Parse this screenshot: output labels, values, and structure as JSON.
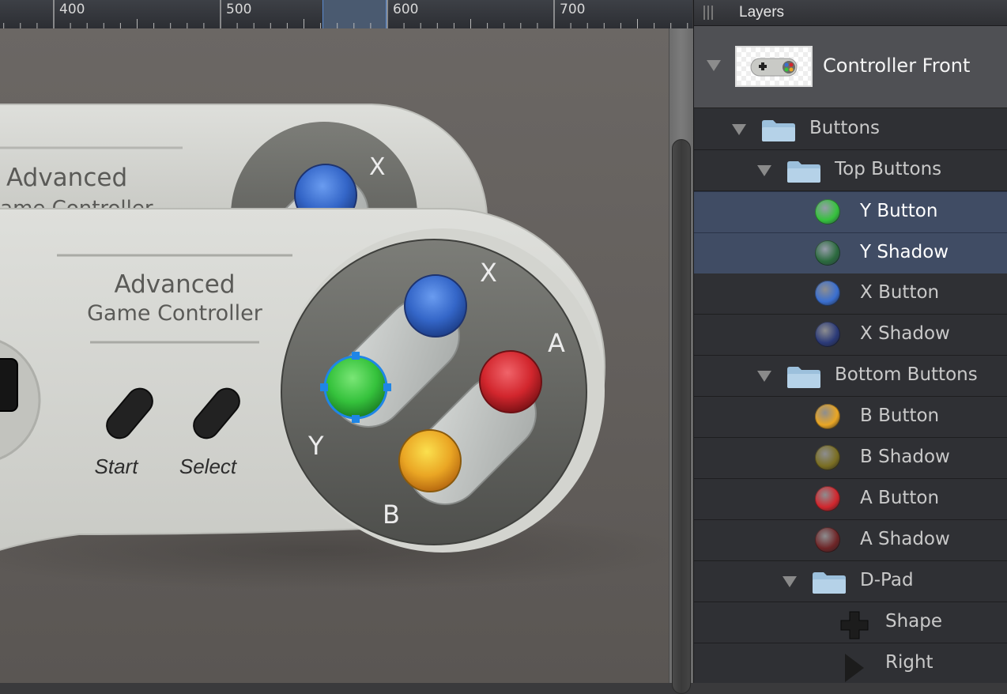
{
  "ruler": {
    "labels": [
      "400",
      "500",
      "600",
      "700"
    ]
  },
  "controller": {
    "title_line1": "Advanced",
    "title_line2": "Game Controller",
    "start_label": "Start",
    "select_label": "Select",
    "letter_x": "X",
    "letter_y": "Y",
    "letter_a": "A",
    "letter_b": "B"
  },
  "layers": {
    "title": "Layers",
    "root": {
      "name": "Controller Front"
    },
    "rows": [
      {
        "label": "Buttons",
        "kind": "folder",
        "selected": false
      },
      {
        "label": "Top Buttons",
        "kind": "folder",
        "selected": false
      },
      {
        "label": "Y Button",
        "kind": "dot",
        "color": "#35c23c",
        "selected": true
      },
      {
        "label": "Y Shadow",
        "kind": "dot",
        "color": "#2b6a3e",
        "selected": true
      },
      {
        "label": "X Button",
        "kind": "dot",
        "color": "#3a6fd0",
        "selected": false
      },
      {
        "label": "X Shadow",
        "kind": "dot",
        "color": "#2b3a78",
        "selected": false
      },
      {
        "label": "Bottom Buttons",
        "kind": "folder",
        "selected": false
      },
      {
        "label": "B Button",
        "kind": "dot",
        "color": "#eaa624",
        "selected": false
      },
      {
        "label": "B Shadow",
        "kind": "dot",
        "color": "#7a6e22",
        "selected": false
      },
      {
        "label": "A Button",
        "kind": "dot",
        "color": "#d2262d",
        "selected": false
      },
      {
        "label": "A Shadow",
        "kind": "dot",
        "color": "#6e2527",
        "selected": false
      },
      {
        "label": "D-Pad",
        "kind": "folder",
        "selected": false
      },
      {
        "label": "Shape",
        "kind": "cross-icon",
        "selected": false
      },
      {
        "label": "Right",
        "kind": "triangle-icon",
        "selected": false
      }
    ]
  },
  "colors": {
    "selection": "#404c64",
    "folder": "#9cc0dc",
    "green_button": "#35c23c",
    "blue_button": "#3a6fd0",
    "red_button": "#d2262d",
    "yellow_button": "#eaa624",
    "selection_handle": "#1f86e6"
  }
}
